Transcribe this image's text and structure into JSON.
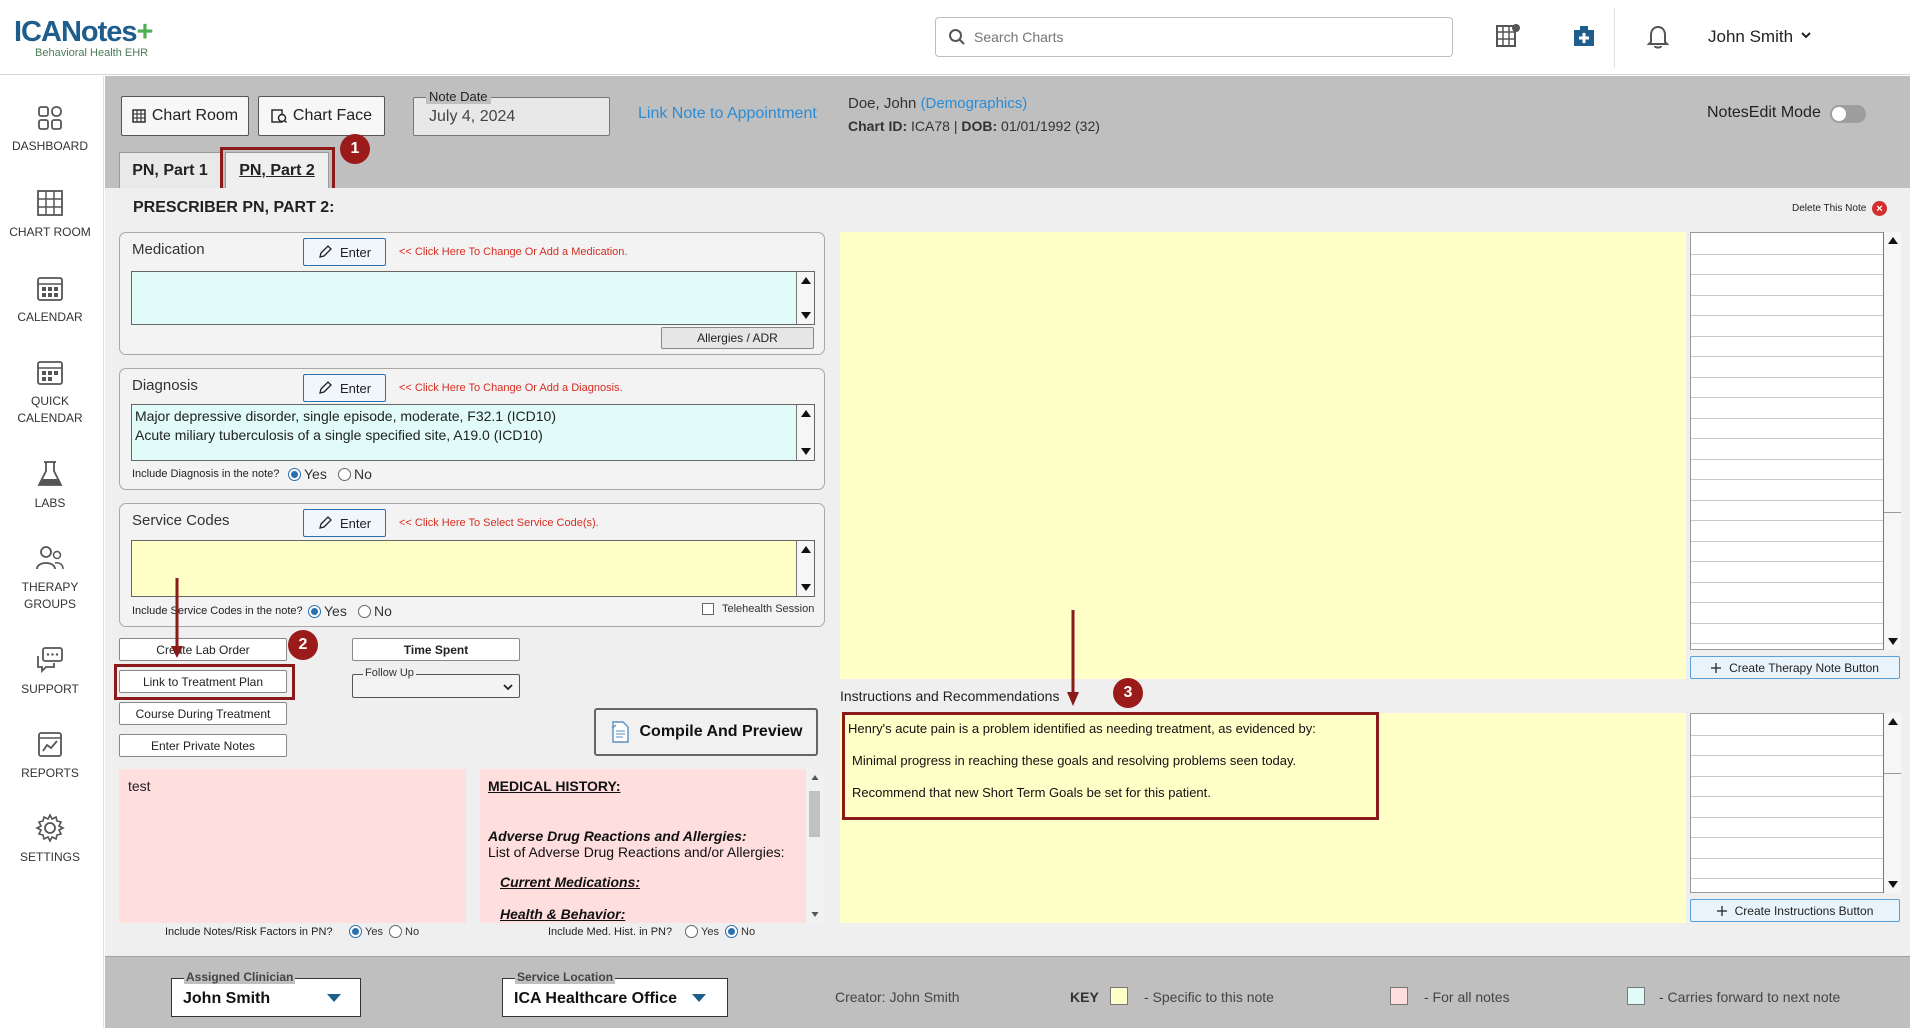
{
  "header": {
    "logo_text": "ICANotes",
    "logo_sub": "Behavioral Health EHR",
    "search_placeholder": "Search Charts",
    "user_name": "John Smith"
  },
  "sidebar": {
    "items": [
      {
        "label": "DASHBOARD",
        "icon": "dashboard-icon"
      },
      {
        "label": "CHART ROOM",
        "icon": "chart-room-icon"
      },
      {
        "label": "CALENDAR",
        "icon": "calendar-icon"
      },
      {
        "label": "QUICK CALENDAR",
        "icon": "quick-calendar-icon"
      },
      {
        "label": "LABS",
        "icon": "flask-icon"
      },
      {
        "label": "THERAPY GROUPS",
        "icon": "group-icon"
      },
      {
        "label": "SUPPORT",
        "icon": "chat-icon"
      },
      {
        "label": "REPORTS",
        "icon": "report-icon"
      },
      {
        "label": "SETTINGS",
        "icon": "gear-icon"
      }
    ]
  },
  "toolbar": {
    "chart_room": "Chart Room",
    "chart_face": "Chart Face",
    "note_date_label": "Note Date",
    "note_date": "July 4, 2024",
    "link_appointment": "Link Note to Appointment",
    "patient_name": "Doe, John",
    "demographics": "(Demographics)",
    "chart_id_label": "Chart ID:",
    "chart_id": "ICA78",
    "dob_label": "DOB:",
    "dob": "01/01/1992 (32)",
    "notes_edit_mode": "NotesEdit Mode"
  },
  "tabs": [
    {
      "label": "PN, Part 1",
      "active": false
    },
    {
      "label": "PN, Part 2",
      "active": true
    }
  ],
  "badges": [
    "1",
    "2",
    "3"
  ],
  "form": {
    "section_title": "PRESCRIBER PN, PART 2:",
    "delete_note": "Delete This Note",
    "enter_label": "Enter",
    "medication": {
      "title": "Medication",
      "hint": "<< Click Here To Change Or Add a Medication.",
      "allergies": "Allergies / ADR"
    },
    "diagnosis": {
      "title": "Diagnosis",
      "hint": "<< Click Here To Change Or Add a Diagnosis.",
      "lines": [
        "Major depressive disorder, single episode, moderate, F32.1 (ICD10)",
        "Acute miliary tuberculosis of a single specified site, A19.0 (ICD10)"
      ],
      "include_label": "Include Diagnosis in the note?",
      "yes": "Yes",
      "no": "No"
    },
    "service_codes": {
      "title": "Service Codes",
      "hint": "<< Click Here To Select Service Code(s).",
      "include_label": "Include Service Codes in the note?",
      "yes": "Yes",
      "no": "No",
      "telehealth": "Telehealth Session"
    },
    "buttons": {
      "create_lab_order": "Create Lab Order",
      "link_treatment_plan": "Link to Treatment Plan",
      "course_treatment": "Course During Treatment",
      "private_notes": "Enter Private Notes",
      "time_spent": "Time Spent",
      "follow_up": "Follow Up",
      "compile": "Compile And Preview"
    },
    "notes_text": "test",
    "include_notes_label": "Include Notes/Risk Factors in PN?",
    "include_med_label": "Include Med. Hist. in PN?",
    "yes": "Yes",
    "no": "No",
    "medical_history": {
      "title": "MEDICAL HISTORY:",
      "adr_title": "Adverse Drug Reactions and Allergies:",
      "adr_text": "List of Adverse Drug Reactions and/or Allergies:",
      "current_meds": "Current Medications:",
      "health_behavior": "Health & Behavior:"
    },
    "instructions_title": "Instructions and Recommendations",
    "instructions_lines": [
      "Henry's acute pain is a problem identified as needing treatment, as evidenced by:",
      "Minimal  progress in reaching these goals and resolving problems seen today.",
      "Recommend that new Short Term Goals be set for this patient."
    ],
    "create_therapy_btn": "Create Therapy Note Button",
    "create_instructions_btn": "Create Instructions Button"
  },
  "footer": {
    "assigned_clinician_label": "Assigned Clinician",
    "assigned_clinician": "John Smith",
    "service_location_label": "Service Location",
    "service_location": "ICA Healthcare Office",
    "creator": "Creator: John Smith",
    "key": "KEY",
    "key_specific": "- Specific to this note",
    "key_all": "- For all notes",
    "key_forward": "- Carries forward to next note"
  },
  "colors": {
    "yellow": "#ffffc8",
    "pink": "#ffdede",
    "cyan": "#e0fbf8",
    "annotation_red": "#8b1a1a",
    "link_blue": "#2b8cd6"
  }
}
